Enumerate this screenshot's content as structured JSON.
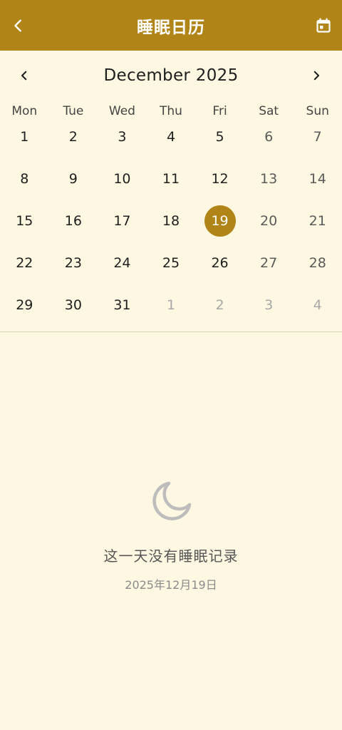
{
  "header": {
    "title": "睡眠日历",
    "back_icon": "chevron-left-icon",
    "calendar_icon": "calendar-icon"
  },
  "calendar": {
    "month_title": "December 2025",
    "weekdays": [
      "Mon",
      "Tue",
      "Wed",
      "Thu",
      "Fri",
      "Sat",
      "Sun"
    ],
    "days": [
      {
        "label": "1",
        "state": "weekday"
      },
      {
        "label": "2",
        "state": "weekday"
      },
      {
        "label": "3",
        "state": "weekday"
      },
      {
        "label": "4",
        "state": "weekday"
      },
      {
        "label": "5",
        "state": "weekday"
      },
      {
        "label": "6",
        "state": "weekend"
      },
      {
        "label": "7",
        "state": "weekend"
      },
      {
        "label": "8",
        "state": "weekday"
      },
      {
        "label": "9",
        "state": "weekday"
      },
      {
        "label": "10",
        "state": "weekday"
      },
      {
        "label": "11",
        "state": "weekday"
      },
      {
        "label": "12",
        "state": "weekday"
      },
      {
        "label": "13",
        "state": "weekend"
      },
      {
        "label": "14",
        "state": "weekend"
      },
      {
        "label": "15",
        "state": "weekday"
      },
      {
        "label": "16",
        "state": "weekday"
      },
      {
        "label": "17",
        "state": "weekday"
      },
      {
        "label": "18",
        "state": "weekday"
      },
      {
        "label": "19",
        "state": "selected"
      },
      {
        "label": "20",
        "state": "weekend"
      },
      {
        "label": "21",
        "state": "weekend"
      },
      {
        "label": "22",
        "state": "weekday"
      },
      {
        "label": "23",
        "state": "weekday"
      },
      {
        "label": "24",
        "state": "weekday"
      },
      {
        "label": "25",
        "state": "weekday"
      },
      {
        "label": "26",
        "state": "weekday"
      },
      {
        "label": "27",
        "state": "weekend"
      },
      {
        "label": "28",
        "state": "weekend"
      },
      {
        "label": "29",
        "state": "weekday"
      },
      {
        "label": "30",
        "state": "weekday"
      },
      {
        "label": "31",
        "state": "weekday"
      },
      {
        "label": "1",
        "state": "outside"
      },
      {
        "label": "2",
        "state": "outside"
      },
      {
        "label": "3",
        "state": "outside"
      },
      {
        "label": "4",
        "state": "outside"
      }
    ]
  },
  "empty_state": {
    "icon": "moon-icon",
    "title": "这一天没有睡眠记录",
    "date": "2025年12月19日"
  },
  "colors": {
    "accent": "#B08416",
    "background": "#FEF8E2",
    "text": "#1E1E1E",
    "muted": "#A8A8A8"
  }
}
